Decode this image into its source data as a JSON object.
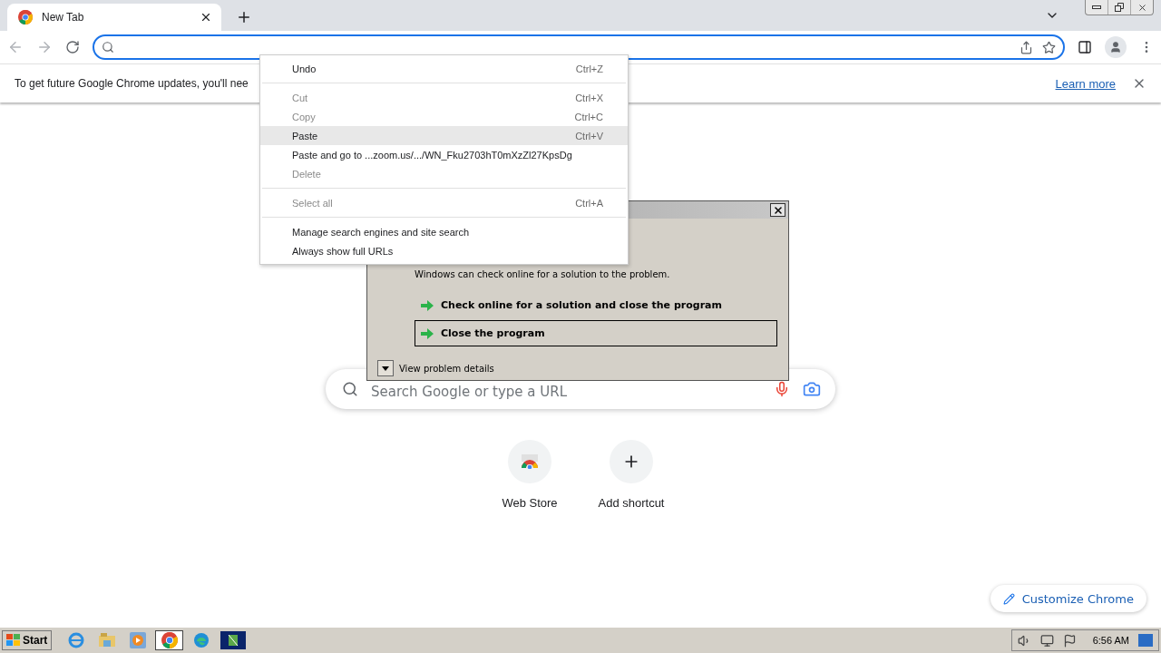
{
  "tab": {
    "title": "New Tab",
    "selected": true
  },
  "infobar": {
    "message": "To get future Google Chrome updates, you'll nee",
    "link": "Learn more"
  },
  "context_menu": {
    "groups": [
      [
        {
          "label": "Undo",
          "shortcut": "Ctrl+Z",
          "disabled": false,
          "selected": false
        }
      ],
      [
        {
          "label": "Cut",
          "shortcut": "Ctrl+X",
          "disabled": true,
          "selected": false
        },
        {
          "label": "Copy",
          "shortcut": "Ctrl+C",
          "disabled": true,
          "selected": false
        },
        {
          "label": "Paste",
          "shortcut": "Ctrl+V",
          "disabled": false,
          "selected": true
        },
        {
          "label": "Paste and go to ...zoom.us/.../WN_Fku2703hT0mXzZl27KpsDg",
          "disabled": false,
          "selected": false
        },
        {
          "label": "Delete",
          "disabled": true,
          "selected": false
        }
      ],
      [
        {
          "label": "Select all",
          "shortcut": "Ctrl+A",
          "disabled": true,
          "selected": false
        }
      ],
      [
        {
          "label": "Manage search engines and site search",
          "disabled": false,
          "selected": false
        },
        {
          "label": "Always show full URLs",
          "disabled": false,
          "selected": false
        }
      ]
    ]
  },
  "error_dialog": {
    "message": "Windows can check online for a solution to the problem.",
    "options": [
      {
        "label": "Check online for a solution and close the program",
        "selected": false
      },
      {
        "label": "Close the program",
        "selected": true
      }
    ],
    "details_toggle": "View problem details"
  },
  "search": {
    "placeholder": "Search Google or type a URL"
  },
  "shortcuts": [
    {
      "label": "Web Store",
      "kind": "store"
    },
    {
      "label": "Add shortcut",
      "kind": "add"
    }
  ],
  "customize_button": "Customize Chrome",
  "taskbar": {
    "start": "Start",
    "tasks": [
      {
        "kind": "chrome",
        "selected": true
      },
      {
        "kind": "edge",
        "selected": false
      },
      {
        "kind": "app",
        "selected": false
      }
    ],
    "clock": "6:56 AM"
  }
}
